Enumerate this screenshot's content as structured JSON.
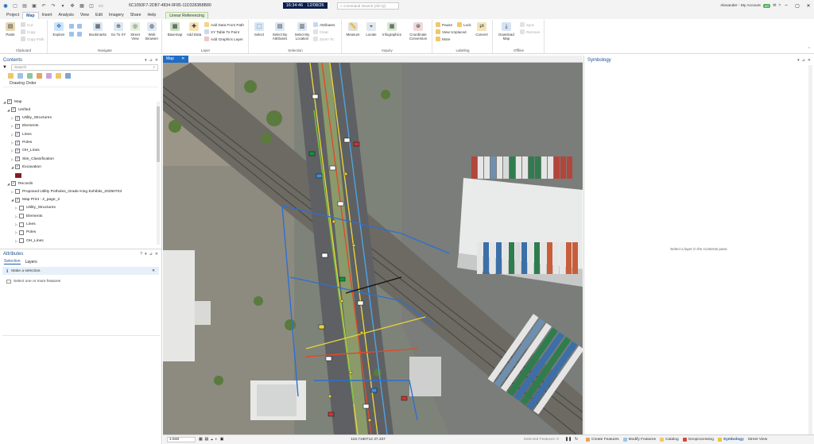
{
  "window": {
    "doc_title": "6C1050F7-2DB7-4834-9F85-11D3283B8B80",
    "search_placeholder": "Command Search (Alt+Q)",
    "clock": "16:34:46",
    "date": "12/08/26",
    "user": "Alexander - My Account",
    "user_badge": "AR"
  },
  "tabs": [
    "Project",
    "Map",
    "Insert",
    "Analysis",
    "View",
    "Edit",
    "Imagery",
    "Share",
    "Help"
  ],
  "active_tab": "Map",
  "context_tab": "Linear Referencing",
  "ribbon": {
    "clipboard": {
      "label": "Clipboard",
      "paste": "Paste",
      "cut": "Cut",
      "copy": "Copy",
      "copy_path": "Copy Path"
    },
    "navigate": {
      "label": "Navigate",
      "explore": "Explore",
      "bookmarks": "Bookmarks",
      "goto": "Go To XY",
      "street_view": "Street View",
      "web_browser": "Web Browser"
    },
    "layer": {
      "label": "Layer",
      "basemap": "Basemap",
      "add_data": "Add Data",
      "add_from_path": "Add Data From Path",
      "xy_table": "XY Table To Point",
      "add_graphics": "Add Graphics Layer"
    },
    "selection": {
      "label": "Selection",
      "select": "Select",
      "by_attr": "Select By Attributes",
      "by_loc": "Select By Location",
      "attributes": "Attributes",
      "clear": "Clear",
      "zoom_to": "Zoom To"
    },
    "inquiry": {
      "label": "Inquiry",
      "measure": "Measure",
      "locate": "Locate",
      "infographics": "Infographics",
      "coord": "Coordinate Conversion"
    },
    "labeling": {
      "label": "Labeling",
      "pause": "Pause",
      "lock": "Lock",
      "view_unplaced": "View Unplaced",
      "more": "More"
    },
    "convert": "Convert",
    "offline": {
      "label": "Offline",
      "download": "Download Map",
      "sync": "Sync",
      "remove": "Remove"
    }
  },
  "contents": {
    "title": "Contents",
    "search_placeholder": "Search",
    "drawing_order": "Drawing Order",
    "rows": [
      {
        "label": "Map",
        "indent": 0,
        "checked": true,
        "twisty": "◢"
      },
      {
        "label": "Unified",
        "indent": 1,
        "checked": true,
        "twisty": "◢"
      },
      {
        "label": "Utility_Structures",
        "indent": 2,
        "checked": true,
        "twisty": "▷"
      },
      {
        "label": "Elements",
        "indent": 2,
        "checked": true,
        "twisty": "▷"
      },
      {
        "label": "Lines",
        "indent": 2,
        "checked": true,
        "twisty": "▷"
      },
      {
        "label": "Poles",
        "indent": 2,
        "checked": true,
        "twisty": "▷"
      },
      {
        "label": "OH_Lines",
        "indent": 2,
        "checked": true,
        "twisty": "▷"
      },
      {
        "label": "Site_Classification",
        "indent": 2,
        "checked": true,
        "twisty": "▷"
      },
      {
        "label": "Excavation",
        "indent": 2,
        "checked": true,
        "twisty": "◢"
      },
      {
        "label": "",
        "indent": 3,
        "swatch": true
      },
      {
        "label": "Records",
        "indent": 1,
        "checked": true,
        "twisty": "◢"
      },
      {
        "label": "Proposed Utility Potholes_Grade King Exhibits_20250703",
        "indent": 2,
        "checked": false,
        "twisty": "▷"
      },
      {
        "label": "Map Print - 2_page_2",
        "indent": 2,
        "checked": true,
        "twisty": "◢"
      },
      {
        "label": "Utility_Structures",
        "indent": 3,
        "checked": false,
        "twisty": "▷"
      },
      {
        "label": "Elements",
        "indent": 3,
        "checked": false,
        "twisty": "▷"
      },
      {
        "label": "Lines",
        "indent": 3,
        "checked": false,
        "twisty": "▷"
      },
      {
        "label": "Poles",
        "indent": 3,
        "checked": false,
        "twisty": "▷"
      },
      {
        "label": "OH_Lines",
        "indent": 3,
        "checked": false,
        "twisty": "▷"
      }
    ]
  },
  "attributes": {
    "title": "Attributes",
    "tab_selection": "Selection",
    "tab_layers": "Layers",
    "info": "Make a selection.",
    "select_msg": "Select one or more features"
  },
  "map": {
    "tab": "Map",
    "scale": "1:948",
    "coords": "118.7180712 37.337",
    "selected": "Selected Features: 0"
  },
  "symbology": {
    "title": "Symbology",
    "message": "Select a layer in the Contents pane."
  },
  "bottom_tabs": [
    "Create Features",
    "Modify Features",
    "Catalog",
    "Geoprocessing",
    "Symbology",
    "Street View"
  ],
  "bottom_active": "Symbology",
  "colors": {
    "accent": "#1f6dc6",
    "ribbon_context": "#eaf3e0",
    "excavation": "#8b1a1a"
  }
}
